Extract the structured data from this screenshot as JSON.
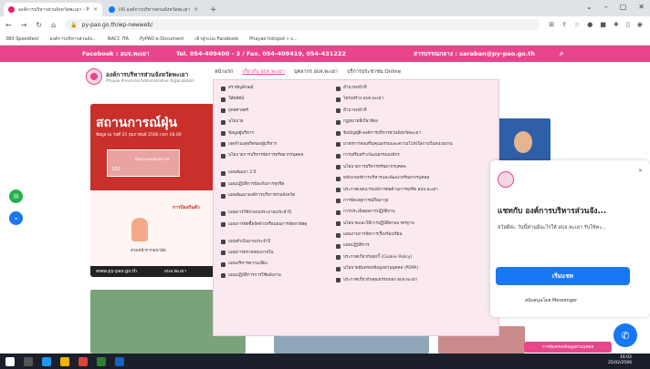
{
  "browser": {
    "tabs": [
      {
        "title": "องค์การบริหารส่วนจังหวัดพะเยา - Ph",
        "active": true
      },
      {
        "title": "(4) องค์การบริหารส่วนจังหวัดพะเยา |",
        "active": false
      }
    ],
    "url": "py-pao.go.th/wp-newweb/",
    "bookmarks": [
      "380 Speedtest",
      "องค์การบริหารส่วนจัง...",
      "NACC ITA",
      "PyPAO e-Document",
      "เข้าสู่ระบบ Facebook",
      "Phayao hotspot » s..."
    ]
  },
  "topbar": {
    "facebook": "Facebook : อบจ.พะเยา",
    "tel": "Tel. 054-409400 - 3 / Fax. 054-409419, 054-431222",
    "email": "สารบรรณกลาง : saraban@py-pao.go.th"
  },
  "header": {
    "org_name": "องค์การบริหารส่วนจังหวัดพะเยา",
    "org_sub": "Phayao Provincial Administrative Organization",
    "nav": [
      "หน้าแรก",
      "เกี่ยวกับ อบจ.พะเยา",
      "บุคลากร อบจ.พะเยา",
      "บริการประชาชน Online"
    ]
  },
  "mega_menu": {
    "col1": [
      "ตราสัญลักษณ์",
      "วิสัยทัศน์",
      "ยุทธศาสตร์",
      "นโยบาย",
      "ข้อมูลผู้บริหาร",
      "เจตจำนงสุจริตของผู้บริหาร",
      "นโยบายการบริหารจัดการทรัพยากรบุคคล",
      "แผนพัฒนา 3 ปี",
      "แผนปฏิบัติการป้องกันการทุจริต",
      "แผนพัฒนาองค์การบริหารส่วนจังหวัด",
      "แผนการใช้จ่ายงบประมาณประจำปี",
      "แผนการจัดซื้อจัดจ้างหรือแผนการจัดหาพัสดุ",
      "แผนดำเนินงานประจำปี",
      "แผนการตรวจสอบภายใน",
      "แผนบริหารความเสี่ยง",
      "แผนปฏิบัติการการใช้พลังงาน"
    ],
    "col2": [
      "อำนาจหน้าที่",
      "โครงสร้าง อบจ.พะเยา",
      "อำนาจหน้าที่",
      "กฎหมายที่เกี่ยวข้อง",
      "ข้อบัญญัติ-องค์การบริหารส่วนจังหวัดพะเยา",
      "มาตรการส่งเสริมคุณธรรมและความโปร่งใสภายในหน่วยงาน",
      "การเสริมสร้างวัฒนธรรมองค์กร",
      "นโยบายการบริหารทรัพยากรบุคคล",
      "หลักเกณฑ์การบริหารและพัฒนาทรัพยากรบุคคล",
      "ประกาศเจตนารมณ์การต่อต้านการทุจริต อบจ.พะเยา",
      "การจัดเหตุการณ์ถืออาวุธ",
      "การประเมินผลการปฏิบัติงาน",
      "นโยบายและวิธีการปฏิบัติตามมาตรฐาน",
      "แผนงานการจัดการเรื่องร้องเรียน",
      "แผนปฏิบัติการ",
      "ประกาศเกี่ยวกับคุกกี้ (Cookie Policy)",
      "นโยบายคุ้มครองข้อมูลส่วนบุคคล (PDPA)",
      "ประกาศเกี่ยวกับคุณธรรมของ อบจ.พะเยา"
    ]
  },
  "banner": {
    "title": "สถานการณ์ฝุ่น",
    "date": "ข้อมูล ณ วันที่ 25 กุมภาพันธ์ 2566 เวลา 08.00",
    "value": "162",
    "level": "มีผลกระทบต่อสุขภาพ",
    "protect": "การป้องกันตัว",
    "caption": "สวมหน้ากากอนามัย",
    "site": "www.py-pao.go.th",
    "fb": "อบจ.พะเยา"
  },
  "chat": {
    "title": "แชทกับ องค์การบริหารส่วนจัง...",
    "message": "สวัสดีค่ะ วันนี้ท่านมีอะไรให้ อบจ.พะเยา รับใช้คะ...",
    "start": "เริ่มแชท",
    "powered": "สนับสนุนโดย Messenger"
  },
  "cookie": "การคุ้มครองข้อมูลส่วนบุคคล",
  "clock": {
    "time": "16:02",
    "date": "25/02/2566"
  }
}
